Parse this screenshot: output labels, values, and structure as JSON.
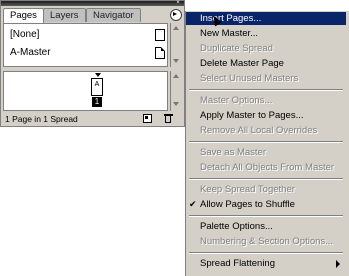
{
  "palette": {
    "tabs": [
      "Pages",
      "Layers",
      "Navigator"
    ],
    "masters": [
      {
        "label": "[None]"
      },
      {
        "label": "A-Master"
      }
    ],
    "page": {
      "master_letter": "A",
      "number": "1"
    },
    "status": "1 Page in 1 Spread"
  },
  "menu": {
    "items": [
      {
        "label": "Insert Pages...",
        "enabled": true,
        "highlighted": true
      },
      {
        "label": "New Master...",
        "enabled": true
      },
      {
        "label": "Duplicate Spread",
        "enabled": false
      },
      {
        "label": "Delete Master Page",
        "enabled": true
      },
      {
        "label": "Select Unused Masters",
        "enabled": false
      },
      {
        "label": "Master Options...",
        "enabled": false
      },
      {
        "label": "Apply Master to Pages...",
        "enabled": true
      },
      {
        "label": "Remove All Local Overrides",
        "enabled": false
      },
      {
        "label": "Save as Master",
        "enabled": false
      },
      {
        "label": "Detach All Objects From Master",
        "enabled": false
      },
      {
        "label": "Keep Spread Together",
        "enabled": false
      },
      {
        "label": "Allow Pages to Shuffle",
        "enabled": true,
        "checked": true
      },
      {
        "label": "Palette Options...",
        "enabled": true
      },
      {
        "label": "Numbering & Section Options...",
        "enabled": false
      },
      {
        "label": "Spread Flattening",
        "enabled": true,
        "submenu": true
      }
    ]
  },
  "colors": {
    "highlight": "#0a246a",
    "panel": "#d4d0c8"
  }
}
